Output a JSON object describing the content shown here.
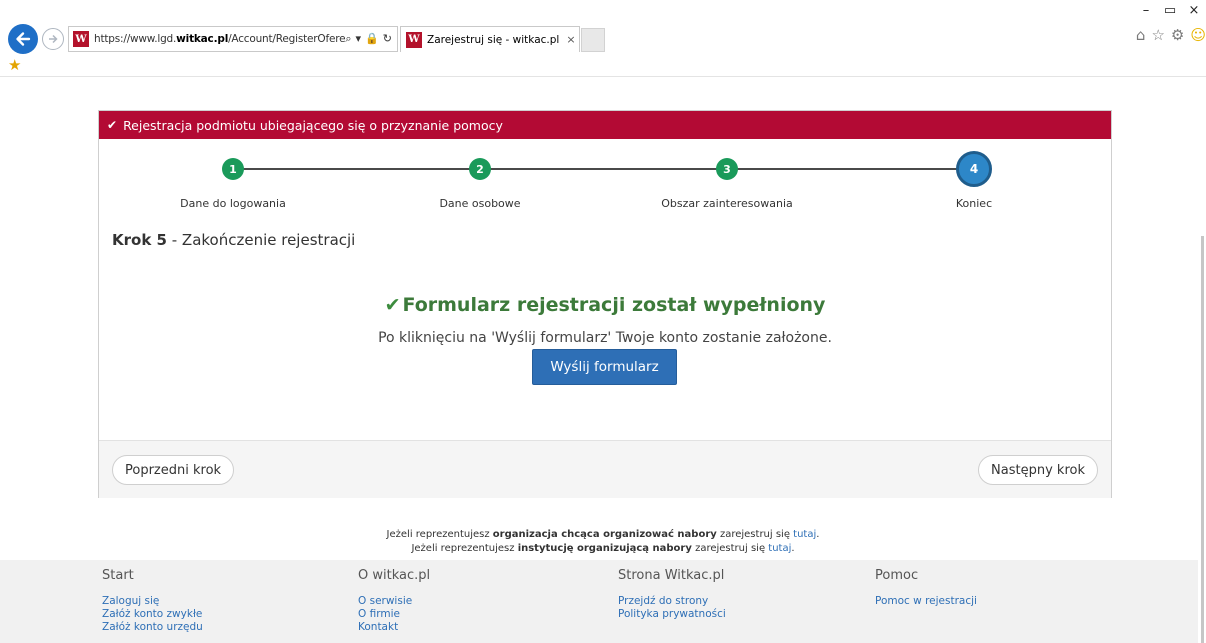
{
  "browser": {
    "address": {
      "prefix": "https://www.lgd.",
      "domain": "witkac.pl",
      "path": "/Account/RegisterOferent"
    },
    "tab_title": "Zarejestruj się - witkac.pl",
    "favicon_letter": "W",
    "tab_close": "×",
    "window_controls": [
      "–",
      "▭",
      "×"
    ],
    "addr_icons": [
      "⌕",
      "▾",
      "🔒",
      "↻"
    ],
    "tool_icons": [
      "⌂",
      "☆",
      "⚙",
      "☺"
    ],
    "favorites_icon": "★"
  },
  "panel": {
    "header": "Rejestracja podmiotu ubiegającego się o przyznanie pomocy",
    "steps": [
      {
        "number": "1",
        "label": "Dane do logowania"
      },
      {
        "number": "2",
        "label": "Dane osobowe"
      },
      {
        "number": "3",
        "label": "Obszar zainteresowania"
      },
      {
        "number": "4",
        "label": "Koniec"
      }
    ],
    "step_heading_bold": "Krok 5",
    "step_heading_rest": " - Zakończenie rejestracji",
    "success_title": "Formularz rejestracji został wypełniony",
    "success_text": "Po kliknięciu na 'Wyślij formularz' Twoje konto zostanie założone.",
    "submit_label": "Wyślij formularz",
    "prev_label": "Poprzedni krok",
    "next_label": "Następny krok"
  },
  "notes": {
    "line1_pre": "Jeżeli reprezentujesz ",
    "line1_bold": "organizacja chcąca organizować nabory",
    "line1_post": " zarejestruj się ",
    "line1_link": "tutaj",
    "line2_pre": "Jeżeli reprezentujesz ",
    "line2_bold": "instytucję organizującą nabory",
    "line2_post": " zarejestruj się ",
    "line2_link": "tutaj",
    "dot": "."
  },
  "footer": {
    "columns": [
      {
        "title": "Start",
        "links": [
          "Zaloguj się",
          "Załóż konto zwykłe",
          "Załóż konto urzędu"
        ]
      },
      {
        "title": "O witkac.pl",
        "links": [
          "O serwisie",
          "O firmie",
          "Kontakt"
        ]
      },
      {
        "title": "Strona Witkac.pl",
        "links": [
          "Przejdź do strony",
          "Polityka prywatności"
        ]
      },
      {
        "title": "Pomoc",
        "links": [
          "Pomoc w rejestracji"
        ]
      }
    ]
  },
  "colors": {
    "header_red": "#b30a34",
    "step_green": "#1a9a5a",
    "step_active_blue": "#2d87c8",
    "success_green": "#3c7a3a",
    "primary_button": "#2e6fb6",
    "link_blue": "#2e6fb6"
  }
}
